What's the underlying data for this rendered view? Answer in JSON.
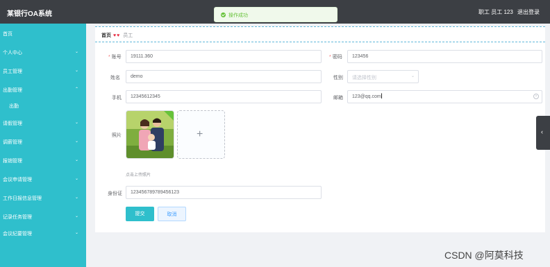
{
  "header": {
    "brand": "某银行OA系统",
    "user": "职工 员工 123",
    "logout": "退出登录"
  },
  "toast": {
    "message": "操作成功"
  },
  "sidebar": {
    "items": [
      {
        "label": "首页",
        "chevron": ""
      },
      {
        "label": "个人中心",
        "chevron": "⌄"
      },
      {
        "label": "员工管理",
        "chevron": "⌄"
      },
      {
        "label": "出勤管理",
        "chevron": "⌃"
      },
      {
        "label": "出勤",
        "chevron": ""
      },
      {
        "label": "请假管理",
        "chevron": "⌄"
      },
      {
        "label": "调薪管理",
        "chevron": "⌄"
      },
      {
        "label": "报销管理",
        "chevron": "⌄"
      },
      {
        "label": "会议申请管理",
        "chevron": "⌄"
      },
      {
        "label": "工作日报信息管理",
        "chevron": "⌄"
      },
      {
        "label": "记录任务管理",
        "chevron": "⌄"
      },
      {
        "label": "会议纪要管理",
        "chevron": "⌄"
      }
    ]
  },
  "breadcrumb": {
    "home": "首页",
    "sep": "♥",
    "current": "员工"
  },
  "form": {
    "account": {
      "label": "账号",
      "value": "19111.360"
    },
    "password": {
      "label": "密码",
      "value": "123456"
    },
    "name": {
      "label": "姓名",
      "value": "demo"
    },
    "gender": {
      "label": "性别",
      "placeholder": "请选择性别"
    },
    "phone": {
      "label": "手机",
      "value": "12345612345"
    },
    "email": {
      "label": "邮箱",
      "value": "123@qq.com"
    },
    "photo": {
      "label": "照片",
      "hint": "点击上传照片"
    },
    "idcard": {
      "label": "身份证",
      "value": "123456789789456123"
    },
    "submit": "提交",
    "cancel": "取消"
  },
  "watermark": "CSDN @阿莫科技",
  "icons": {
    "success": "check-circle-icon",
    "upload": "plus-icon",
    "side_toggle": "chevron-left-icon"
  },
  "colors": {
    "sidebar": "#2fbfcc",
    "topbar": "#3c3f44",
    "primary": "#2fbfcc",
    "success": "#67c23a"
  }
}
